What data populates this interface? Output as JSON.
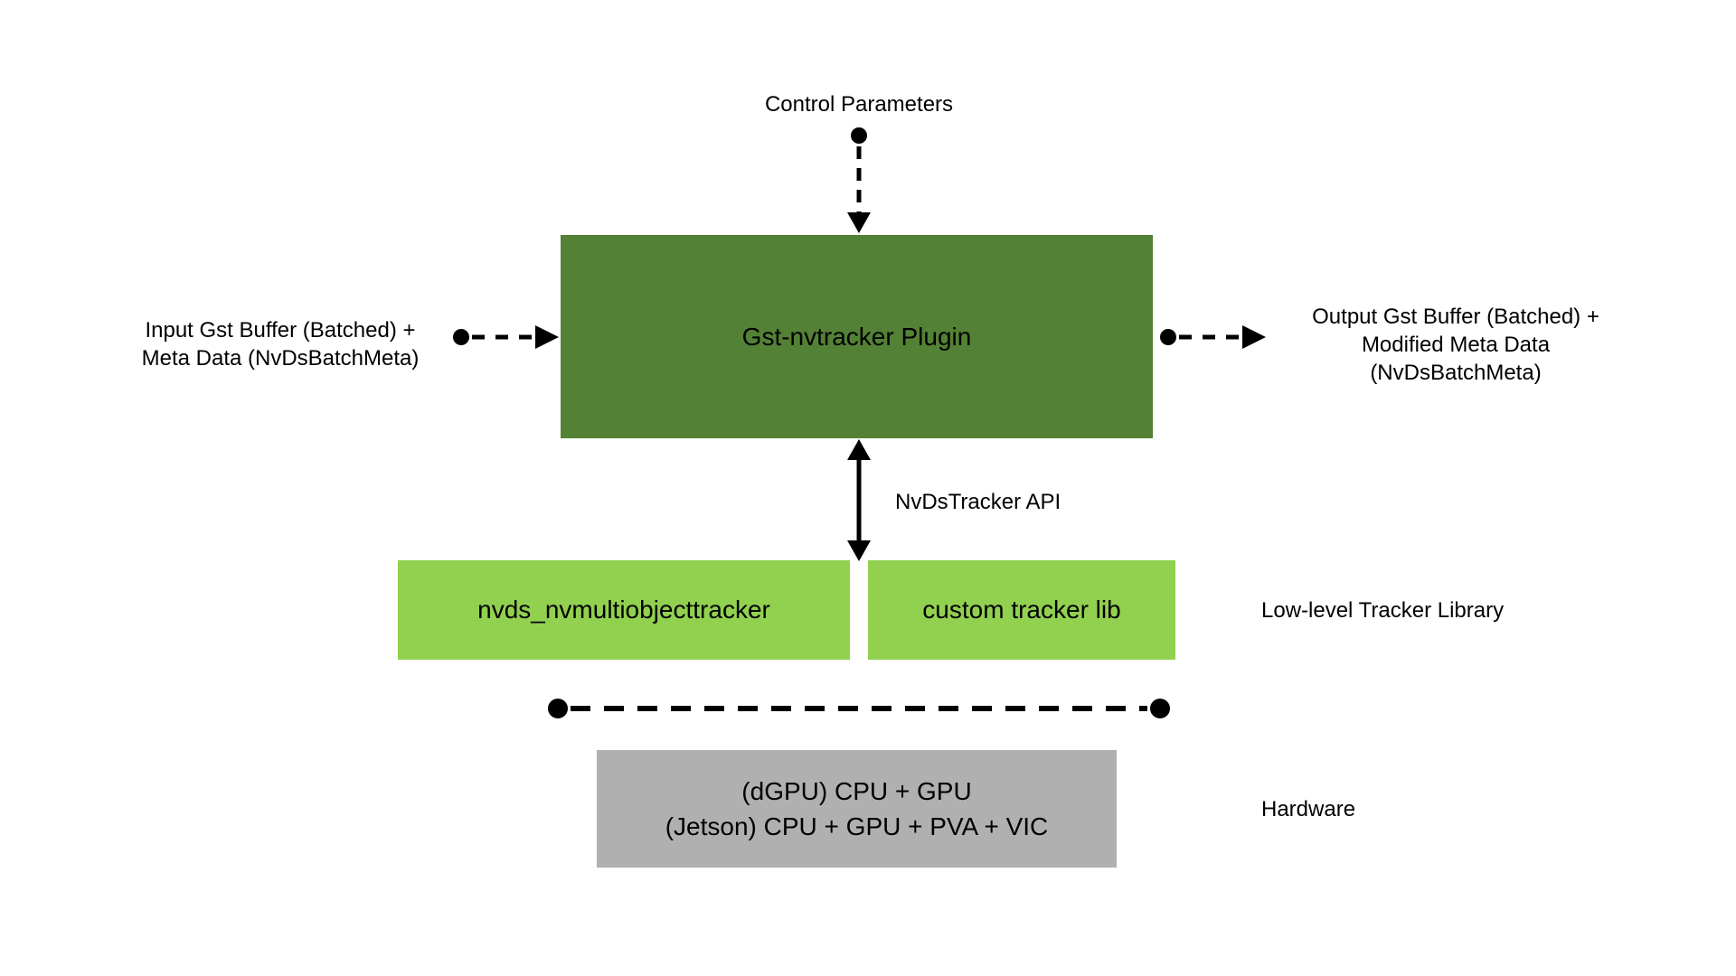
{
  "top_label": "Control Parameters",
  "input_label_line1": "Input Gst Buffer (Batched) +",
  "input_label_line2": "Meta Data (NvDsBatchMeta)",
  "output_label_line1": "Output Gst Buffer (Batched) +",
  "output_label_line2": "Modified Meta Data",
  "output_label_line3": "(NvDsBatchMeta)",
  "plugin_box": "Gst-nvtracker Plugin",
  "api_label": "NvDsTracker API",
  "lib1": "nvds_nvmultiobjecttracker",
  "lib2": "custom tracker lib",
  "lib_layer_label": "Low-level Tracker Library",
  "hw_line1": "(dGPU) CPU + GPU",
  "hw_line2": "(Jetson) CPU + GPU + PVA + VIC",
  "hw_label": "Hardware",
  "colors": {
    "dark_green": "#538135",
    "light_green": "#92d050",
    "gray": "#b0b0b0"
  }
}
